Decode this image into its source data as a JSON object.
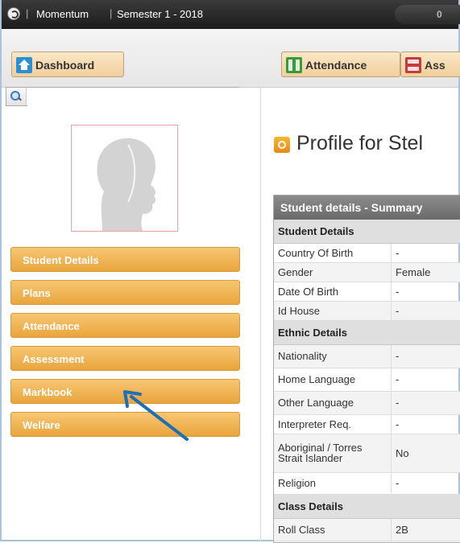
{
  "topbar": {
    "app_name": "Momentum",
    "semester": "Semester 1 - 2018",
    "count": "0"
  },
  "nav": [
    {
      "label": "Dashboard",
      "icon": "home-icon"
    },
    {
      "label": "Attendance",
      "icon": "attendance-icon"
    },
    {
      "label": "Ass",
      "icon": "assessment-icon"
    }
  ],
  "search": {
    "placeholder": "",
    "value": ""
  },
  "sidebar": {
    "items": [
      {
        "label": "Student Details"
      },
      {
        "label": "Plans"
      },
      {
        "label": "Attendance"
      },
      {
        "label": "Assessment"
      },
      {
        "label": "Markbook"
      },
      {
        "label": "Welfare"
      }
    ]
  },
  "profile": {
    "title": "Profile for Stel",
    "card_title": "Student details - Summary",
    "sections": [
      {
        "heading": "Student Details",
        "rows": [
          {
            "label": "Country Of Birth",
            "value": "-"
          },
          {
            "label": "Gender",
            "value": "Female"
          },
          {
            "label": "Date Of Birth",
            "value": "-"
          },
          {
            "label": "Id House",
            "value": "-"
          }
        ]
      },
      {
        "heading": "Ethnic Details",
        "rows": [
          {
            "label": "Nationality",
            "value": "-"
          },
          {
            "label": "Home Language",
            "value": "-"
          },
          {
            "label": "Other Language",
            "value": "-"
          },
          {
            "label": "Interpreter Req.",
            "value": "-"
          },
          {
            "label": "Aboriginal / Torres Strait Islander",
            "value": "No"
          },
          {
            "label": "Religion",
            "value": "-"
          }
        ]
      },
      {
        "heading": "Class Details",
        "rows": [
          {
            "label": "Roll Class",
            "value": "2B"
          }
        ]
      }
    ]
  },
  "colors": {
    "nav_button": "#f1cf9b",
    "sidebar_item": "#e9a53c",
    "card_header": "#7a7a7a",
    "annotation_arrow": "#1f6fb5"
  }
}
